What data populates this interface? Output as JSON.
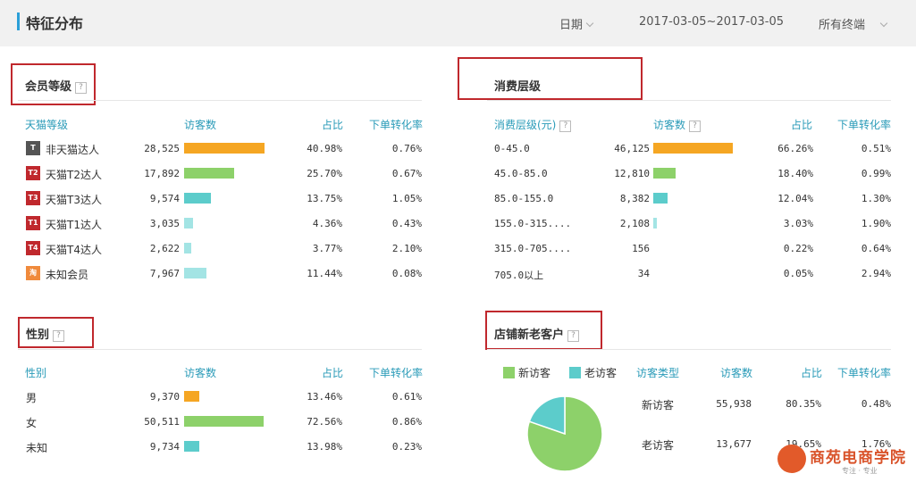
{
  "header": {
    "title": "特征分布",
    "date_label": "日期",
    "date_range": "2017-03-05~2017-03-05",
    "terminal": "所有终端"
  },
  "colors": {
    "orange": "#f5a623",
    "green": "#8dd16a",
    "teal": "#5ccccb",
    "lightteal": "#a3e4e4",
    "accent": "#2a9bb8",
    "red": "#c0282d"
  },
  "member": {
    "title": "会员等级",
    "help": "?",
    "headers": [
      "天猫等级",
      "访客数",
      "占比",
      "下单转化率"
    ],
    "rows": [
      {
        "icon": "T",
        "icon_color": "#555555",
        "label": "非天猫达人",
        "visitors": "28,525",
        "share": "40.98%",
        "conv": "0.76%",
        "pct": 40.98,
        "color": "#f5a623"
      },
      {
        "icon": "T2",
        "icon_color": "#c0282d",
        "label": "天猫T2达人",
        "visitors": "17,892",
        "share": "25.70%",
        "conv": "0.67%",
        "pct": 25.7,
        "color": "#8dd16a"
      },
      {
        "icon": "T3",
        "icon_color": "#c0282d",
        "label": "天猫T3达人",
        "visitors": "9,574",
        "share": "13.75%",
        "conv": "1.05%",
        "pct": 13.75,
        "color": "#5ccccb"
      },
      {
        "icon": "T1",
        "icon_color": "#c0282d",
        "label": "天猫T1达人",
        "visitors": "3,035",
        "share": "4.36%",
        "conv": "0.43%",
        "pct": 4.36,
        "color": "#a3e4e4"
      },
      {
        "icon": "T4",
        "icon_color": "#c0282d",
        "label": "天猫T4达人",
        "visitors": "2,622",
        "share": "3.77%",
        "conv": "2.10%",
        "pct": 3.77,
        "color": "#a3e4e4"
      },
      {
        "icon": "淘",
        "icon_color": "#f08a3c",
        "label": "未知会员",
        "visitors": "7,967",
        "share": "11.44%",
        "conv": "0.08%",
        "pct": 11.44,
        "color": "#a3e4e4"
      }
    ]
  },
  "spend": {
    "title": "消费层级",
    "headers": [
      "消费层级(元)",
      "访客数",
      "占比",
      "下单转化率"
    ],
    "help": "?",
    "rows": [
      {
        "label": "0-45.0",
        "visitors": "46,125",
        "share": "66.26%",
        "conv": "0.51%",
        "pct": 66.26,
        "color": "#f5a623"
      },
      {
        "label": "45.0-85.0",
        "visitors": "12,810",
        "share": "18.40%",
        "conv": "0.99%",
        "pct": 18.4,
        "color": "#8dd16a"
      },
      {
        "label": "85.0-155.0",
        "visitors": "8,382",
        "share": "12.04%",
        "conv": "1.30%",
        "pct": 12.04,
        "color": "#5ccccb"
      },
      {
        "label": "155.0-315....",
        "visitors": "2,108",
        "share": "3.03%",
        "conv": "1.90%",
        "pct": 3.03,
        "color": "#a3e4e4"
      },
      {
        "label": "315.0-705....",
        "visitors": "156",
        "share": "0.22%",
        "conv": "0.64%",
        "pct": 0.22,
        "color": "#a3e4e4"
      },
      {
        "label": "705.0以上",
        "visitors": "34",
        "share": "0.05%",
        "conv": "2.94%",
        "pct": 0.05,
        "color": "#a3e4e4"
      }
    ]
  },
  "gender": {
    "title": "性别",
    "help": "?",
    "headers": [
      "性别",
      "访客数",
      "占比",
      "下单转化率"
    ],
    "rows": [
      {
        "label": "男",
        "visitors": "9,370",
        "share": "13.46%",
        "conv": "0.61%",
        "pct": 13.46,
        "color": "#f5a623"
      },
      {
        "label": "女",
        "visitors": "50,511",
        "share": "72.56%",
        "conv": "0.86%",
        "pct": 72.56,
        "color": "#8dd16a"
      },
      {
        "label": "未知",
        "visitors": "9,734",
        "share": "13.98%",
        "conv": "0.23%",
        "pct": 13.98,
        "color": "#5ccccb"
      }
    ]
  },
  "customers": {
    "title": "店铺新老客户",
    "help": "?",
    "legend": [
      {
        "label": "新访客",
        "color": "#8dd16a"
      },
      {
        "label": "老访客",
        "color": "#5ccccb"
      }
    ],
    "headers": [
      "访客类型",
      "访客数",
      "占比",
      "下单转化率"
    ],
    "rows": [
      {
        "label": "新访客",
        "visitors": "55,938",
        "share": "80.35%",
        "conv": "0.48%"
      },
      {
        "label": "老访客",
        "visitors": "13,677",
        "share": "19.65%",
        "conv": "1.76%"
      }
    ],
    "pie": [
      80.35,
      19.65
    ]
  },
  "logo": {
    "name": "商苑电商学院",
    "sub": "专注 · 专业"
  }
}
